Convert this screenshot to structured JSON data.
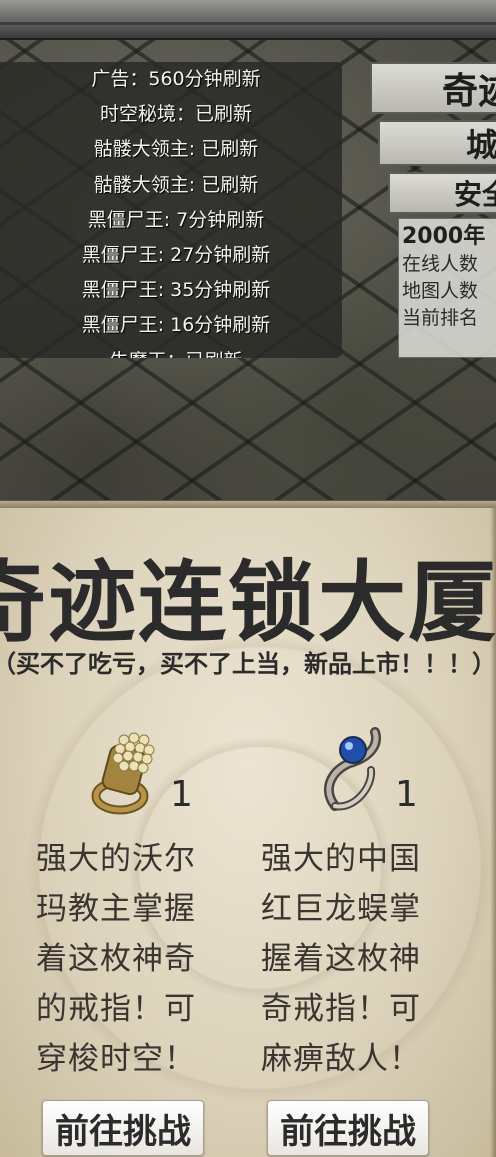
{
  "boss_timers": [
    "广告：560分钟刷新",
    "时空秘境：已刷新",
    "骷髅大领主: 已刷新",
    "骷髅大领主: 已刷新",
    "黑僵尸王: 7分钟刷新",
    "黑僵尸王: 27分钟刷新",
    "黑僵尸王: 35分钟刷新",
    "黑僵尸王: 16分钟刷新",
    "牛魔王：已刷新"
  ],
  "info_panel": {
    "title": "奇迹",
    "zone": "城",
    "safety": "安全",
    "year": "2000年",
    "online_label": "在线人数",
    "map_label": "地图人数",
    "rank_label": "当前排名"
  },
  "shop": {
    "title": "奇迹连锁大厦",
    "subtitle": "（买不了吃亏，买不了上当，新品上市！！！）",
    "items": [
      {
        "icon": "gold-pearl-ring-icon",
        "quantity": "1",
        "desc_lines": [
          "强大的沃尔",
          "玛教主掌握",
          "着这枚神奇",
          "的戒指！可",
          "穿梭时空！"
        ],
        "button": "前往挑战"
      },
      {
        "icon": "blue-gem-ring-icon",
        "quantity": "1",
        "desc_lines": [
          "强大的中国",
          "红巨龙蜈掌",
          "握着这枚神",
          "奇戒指！可",
          "麻痹敌人！"
        ],
        "button": "前往挑战"
      }
    ]
  },
  "colors": {
    "panel_bg": "#2b2b27",
    "parchment": "#e4dcc8",
    "text_dark": "#2b2b2b"
  }
}
